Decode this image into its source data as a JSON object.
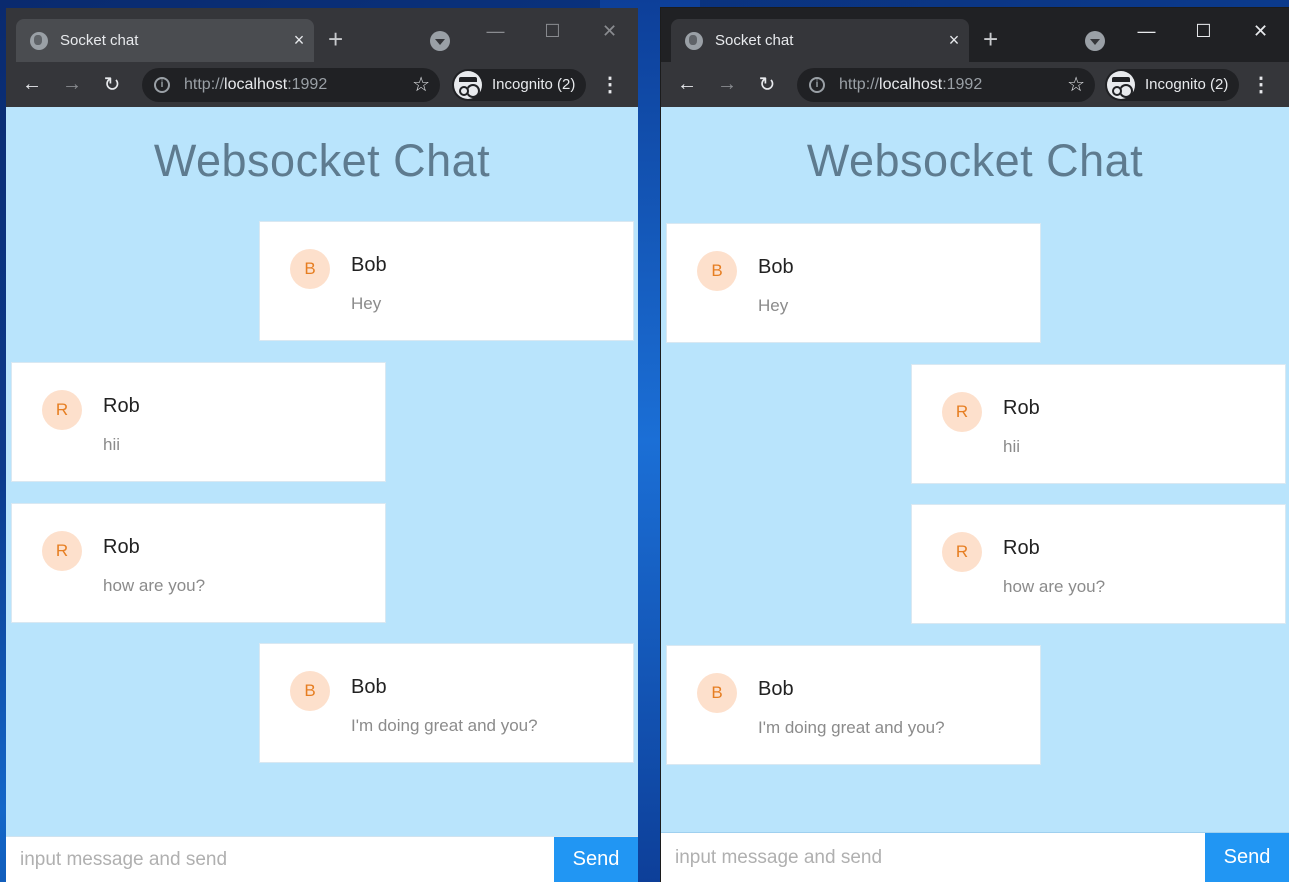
{
  "windows": [
    {
      "tab_title": "Socket chat",
      "url_scheme": "http://",
      "url_host": "localhost",
      "url_port": ":1992",
      "incognito_label": "Incognito (2)",
      "page_title": "Websocket Chat",
      "messages": [
        {
          "avatar": "B",
          "name": "Bob",
          "text": "Hey"
        },
        {
          "avatar": "R",
          "name": "Rob",
          "text": "hii"
        },
        {
          "avatar": "R",
          "name": "Rob",
          "text": "how are you?"
        },
        {
          "avatar": "B",
          "name": "Bob",
          "text": "I'm doing great and you?"
        }
      ],
      "input_placeholder": "input message and send",
      "send_label": "Send"
    },
    {
      "tab_title": "Socket chat",
      "url_scheme": "http://",
      "url_host": "localhost",
      "url_port": ":1992",
      "incognito_label": "Incognito (2)",
      "page_title": "Websocket Chat",
      "messages": [
        {
          "avatar": "B",
          "name": "Bob",
          "text": "Hey"
        },
        {
          "avatar": "R",
          "name": "Rob",
          "text": "hii"
        },
        {
          "avatar": "R",
          "name": "Rob",
          "text": "how are you?"
        },
        {
          "avatar": "B",
          "name": "Bob",
          "text": "I'm doing great and you?"
        }
      ],
      "input_placeholder": "input message and send",
      "send_label": "Send"
    }
  ],
  "icons": {
    "tab_close": "×",
    "new_tab": "+",
    "back": "←",
    "forward": "→",
    "reload": "↻",
    "star": "☆",
    "menu": "⋮",
    "minimize": "—",
    "maximize": "☐",
    "close": "✕"
  },
  "colors": {
    "page_bg": "#b9e4fc",
    "avatar_bg": "#fde0cc",
    "avatar_fg": "#e67e22",
    "send_bg": "#2196f3",
    "title_fg": "#5e7b8f"
  }
}
